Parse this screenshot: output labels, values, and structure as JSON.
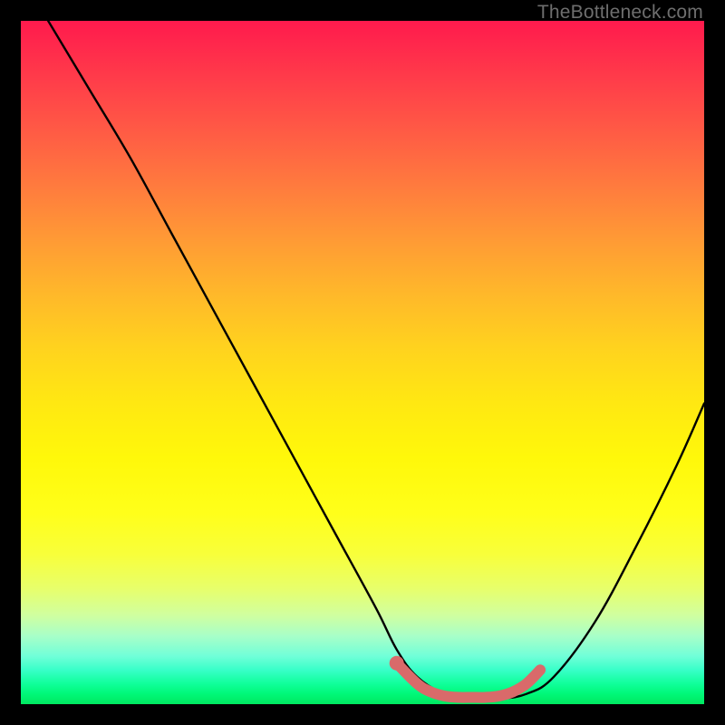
{
  "watermark": "TheBottleneck.com",
  "chart_data": {
    "type": "line",
    "title": "",
    "xlabel": "",
    "ylabel": "",
    "xlim": [
      0,
      100
    ],
    "ylim": [
      0,
      100
    ],
    "grid": false,
    "series": [
      {
        "name": "bottleneck-curve",
        "color": "#000000",
        "x": [
          4,
          10,
          16,
          22,
          28,
          34,
          40,
          46,
          52,
          55,
          58,
          62,
          66,
          70,
          74,
          78,
          84,
          90,
          96,
          100
        ],
        "y": [
          100,
          90,
          80,
          69,
          58,
          47,
          36,
          25,
          14,
          8,
          4,
          1.5,
          0.8,
          0.8,
          1.5,
          4,
          12,
          23,
          35,
          44
        ]
      },
      {
        "name": "recommended-range",
        "color": "#d96a6a",
        "type": "line",
        "x": [
          55,
          58,
          60,
          62,
          64,
          66,
          68,
          70,
          72,
          74,
          76
        ],
        "y": [
          6,
          3,
          1.8,
          1.2,
          1.0,
          1.0,
          1.0,
          1.2,
          1.8,
          3,
          5
        ]
      }
    ],
    "annotations": []
  }
}
